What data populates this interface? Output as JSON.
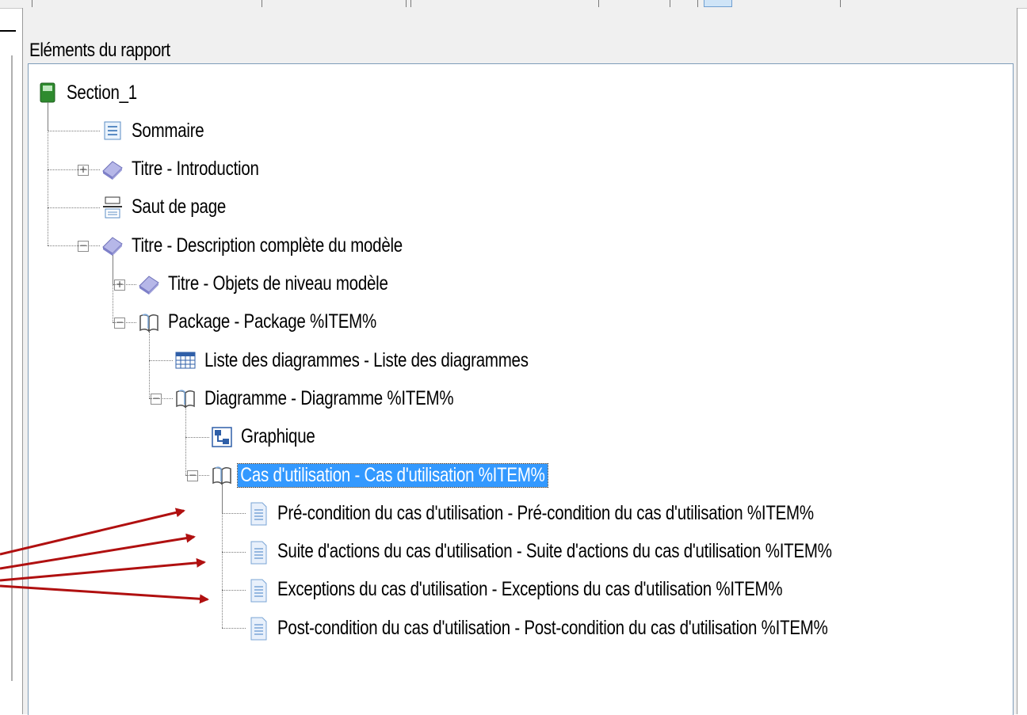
{
  "panel": {
    "title": "Eléments du rapport"
  },
  "tree": {
    "items": [
      {
        "label": "Section_1",
        "icon": "section-icon",
        "level": 0,
        "expander": null
      },
      {
        "label": "Sommaire",
        "icon": "table-of-contents-icon",
        "level": 1,
        "expander": null
      },
      {
        "label": "Titre - Introduction",
        "icon": "title-book-icon",
        "level": 1,
        "expander": "+"
      },
      {
        "label": "Saut de page",
        "icon": "page-break-icon",
        "level": 1,
        "expander": null
      },
      {
        "label": "Titre - Description complète du modèle",
        "icon": "title-book-icon",
        "level": 1,
        "expander": "-"
      },
      {
        "label": "Titre - Objets de niveau modèle",
        "icon": "title-book-icon",
        "level": 2,
        "expander": "+"
      },
      {
        "label": "Package - Package %ITEM%",
        "icon": "open-book-icon",
        "level": 2,
        "expander": "-"
      },
      {
        "label": "Liste des diagrammes - Liste des diagrammes",
        "icon": "grid-list-icon",
        "level": 3,
        "expander": null
      },
      {
        "label": "Diagramme - Diagramme %ITEM%",
        "icon": "open-book-icon",
        "level": 3,
        "expander": "-"
      },
      {
        "label": "Graphique",
        "icon": "graphic-icon",
        "level": 4,
        "expander": null
      },
      {
        "label": "Cas d'utilisation - Cas d'utilisation %ITEM%",
        "icon": "open-book-icon",
        "level": 4,
        "expander": "-",
        "selected": true
      },
      {
        "label": "Pré-condition du cas d'utilisation - Pré-condition du cas d'utilisation %ITEM%",
        "icon": "document-icon",
        "level": 5,
        "expander": null
      },
      {
        "label": "Suite d'actions du cas d'utilisation - Suite d'actions du cas d'utilisation %ITEM%",
        "icon": "document-icon",
        "level": 5,
        "expander": null
      },
      {
        "label": "Exceptions du cas d'utilisation - Exceptions du cas d'utilisation %ITEM%",
        "icon": "document-icon",
        "level": 5,
        "expander": null
      },
      {
        "label": "Post-condition du cas d'utilisation - Post-condition du cas d'utilisation %ITEM%",
        "icon": "document-icon",
        "level": 5,
        "expander": null
      }
    ]
  },
  "annotation": {
    "arrow_color": "#b01010",
    "arrow_count": 4
  },
  "colors": {
    "selection": "#3399ff",
    "panel_bg": "#f0f0f0"
  }
}
